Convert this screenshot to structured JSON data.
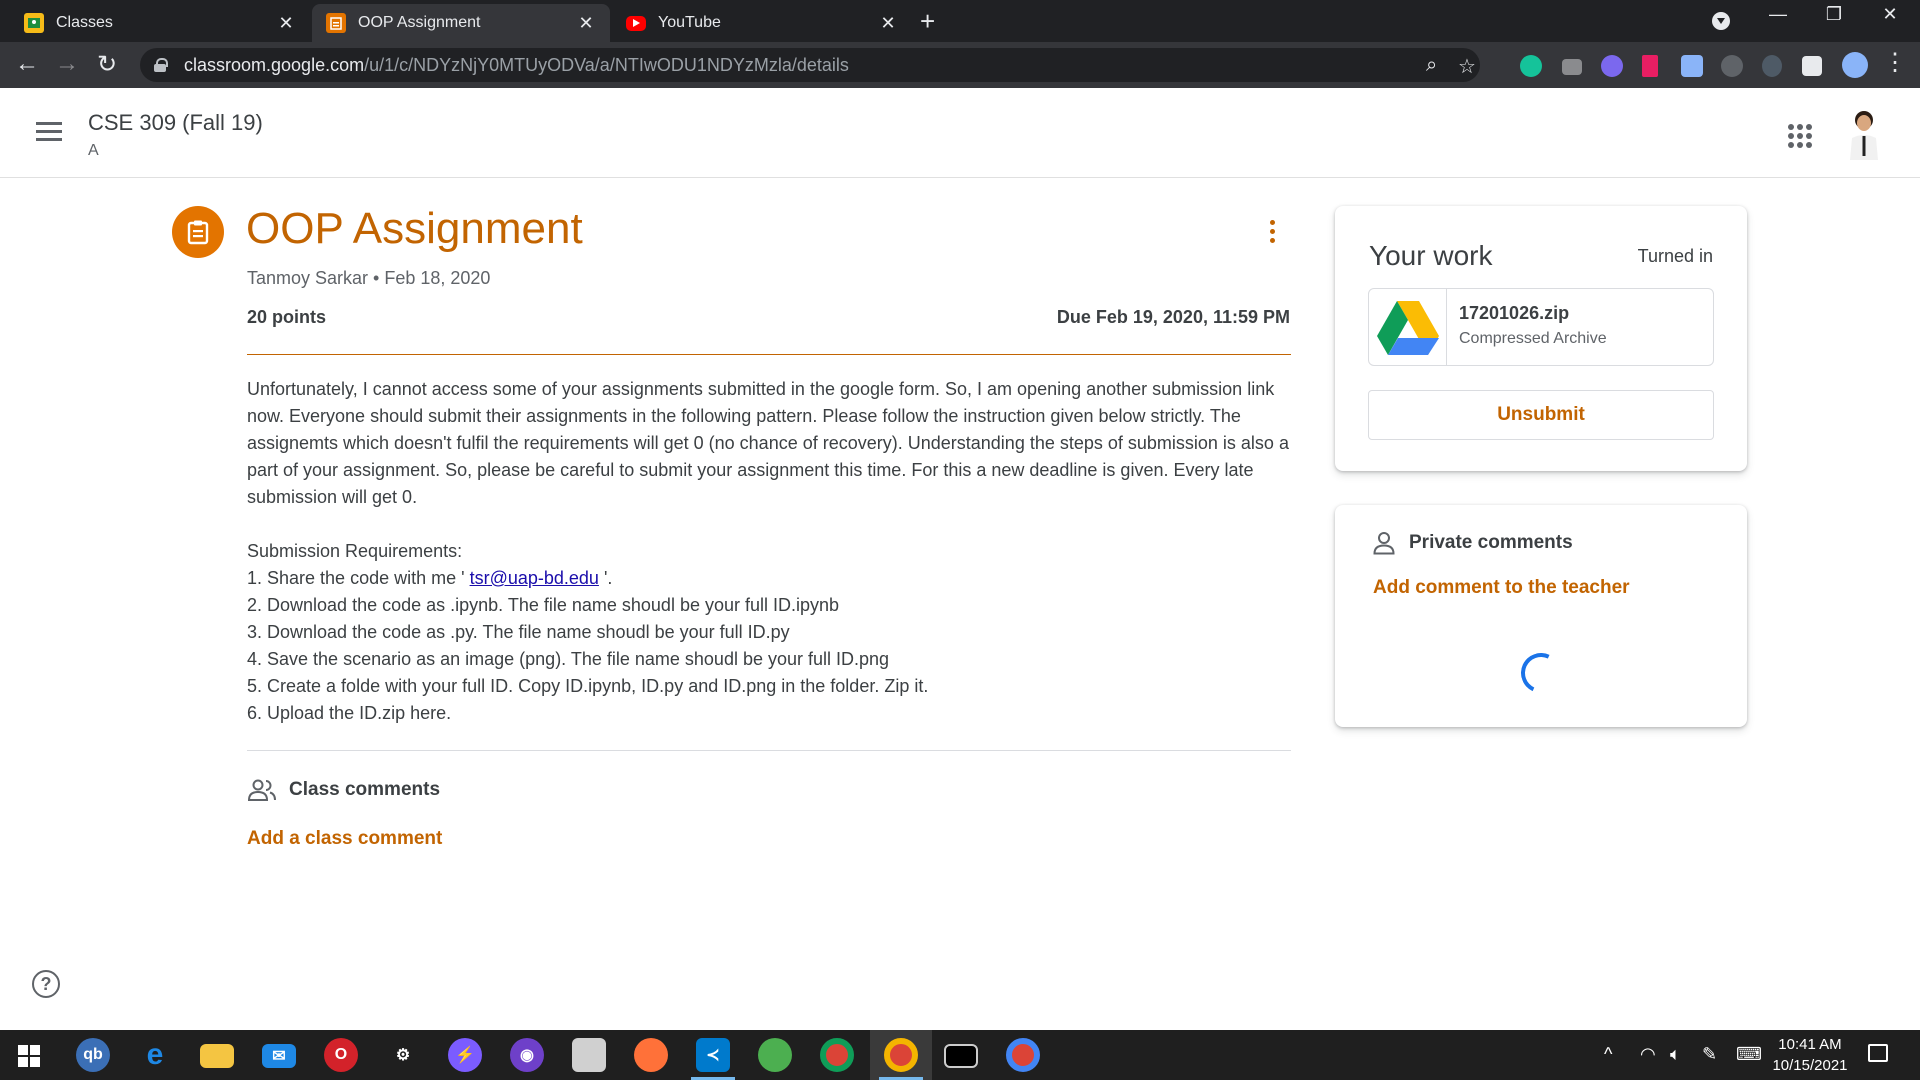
{
  "browser": {
    "tabs": [
      {
        "title": "Classes",
        "active": false
      },
      {
        "title": "OOP Assignment",
        "active": true
      },
      {
        "title": "YouTube",
        "active": false
      }
    ],
    "new_tab_label": "+",
    "url_host": "classroom.google.com",
    "url_path": "/u/1/c/NDYzNjY0MTUyODVa/a/NTIwODU1NDYzMzla/details"
  },
  "header": {
    "class_name": "CSE 309 (Fall 19)",
    "section": "A"
  },
  "assignment": {
    "title": "OOP Assignment",
    "author_date": "Tanmoy Sarkar • Feb 18, 2020",
    "points": "20 points",
    "due": "Due Feb 19, 2020, 11:59 PM",
    "description": "Unfortunately, I cannot access some of your assignments submitted in the google form. So, I am opening another submission link now. Everyone should submit their assignments in the following pattern. Please follow the instruction given below strictly. The assignemts which doesn't fulfil the requirements will get 0 (no chance of recovery). Understanding the steps of submission is also a part of your assignment. So, please be careful to submit your assignment this time. For this a new deadline is given. Every late submission will get 0.",
    "requirements_heading": "Submission Requirements:",
    "req1_prefix": "1. Share the code with me '",
    "req1_email": "tsr@uap-bd.edu",
    "req1_suffix": "'.",
    "req2": "2. Download the code as .ipynb. The file name shoudl be your full ID.ipynb",
    "req3": "3. Download the code as .py. The file name shoudl be your full ID.py",
    "req4": "4. Save the scenario as an image (png). The file name shoudl be your full ID.png",
    "req5": "5. Create a folde with your full ID. Copy ID.ipynb, ID.py and ID.png in the folder. Zip it.",
    "req6": "6. Upload the ID.zip here."
  },
  "class_comments": {
    "heading": "Class comments",
    "add_label": "Add a class comment"
  },
  "your_work": {
    "title": "Your work",
    "status": "Turned in",
    "file_name": "17201026.zip",
    "file_type": "Compressed Archive",
    "unsubmit_label": "Unsubmit"
  },
  "private_comments": {
    "heading": "Private comments",
    "add_label": "Add comment to the teacher"
  },
  "help_label": "?",
  "taskbar": {
    "time": "10:41 AM",
    "date": "10/15/2021"
  },
  "colors": {
    "accent": "#c26401",
    "icon_bg": "#e37400",
    "link": "#1a0dab",
    "spinner": "#1a73e8"
  }
}
